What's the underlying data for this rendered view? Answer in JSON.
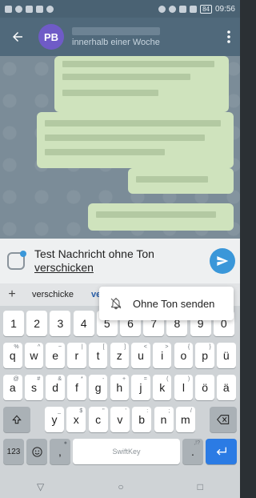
{
  "status_bar": {
    "battery": "84",
    "time": "09:56"
  },
  "header": {
    "back_icon": "arrow-left-icon",
    "avatar_initials": "PB",
    "subtitle": "innerhalb einer Woche",
    "menu_icon": "more-vertical-icon"
  },
  "composer": {
    "text_line1": "Test Nachricht ohne Ton",
    "text_line2": "verschicken",
    "sticker_icon": "sticker-icon",
    "send_icon": "send-icon"
  },
  "suggestions": {
    "add": "+",
    "word1": "verschicke",
    "word2": "ve"
  },
  "popup": {
    "label": "Ohne Ton senden",
    "icon": "bell-off-icon"
  },
  "keyboard": {
    "row1": [
      {
        "k": "1"
      },
      {
        "k": "2"
      },
      {
        "k": "3"
      },
      {
        "k": "4"
      },
      {
        "k": "5"
      },
      {
        "k": "6"
      },
      {
        "k": "7"
      },
      {
        "k": "8"
      },
      {
        "k": "9"
      },
      {
        "k": "0"
      }
    ],
    "row2": [
      {
        "k": "q",
        "s": "%"
      },
      {
        "k": "w",
        "s": "^"
      },
      {
        "k": "e",
        "s": "~"
      },
      {
        "k": "r",
        "s": "|"
      },
      {
        "k": "t",
        "s": "["
      },
      {
        "k": "z",
        "s": "]"
      },
      {
        "k": "u",
        "s": "<"
      },
      {
        "k": "i",
        "s": ">"
      },
      {
        "k": "o",
        "s": "{"
      },
      {
        "k": "p",
        "s": "}"
      },
      {
        "k": "ü"
      }
    ],
    "row3": [
      {
        "k": "a",
        "s": "@"
      },
      {
        "k": "s",
        "s": "#"
      },
      {
        "k": "d",
        "s": "&"
      },
      {
        "k": "f",
        "s": "*"
      },
      {
        "k": "g",
        "s": "-"
      },
      {
        "k": "h",
        "s": "+"
      },
      {
        "k": "j",
        "s": "="
      },
      {
        "k": "k",
        "s": "("
      },
      {
        "k": "l",
        "s": ")"
      },
      {
        "k": "ö"
      },
      {
        "k": "ä"
      }
    ],
    "row4": [
      {
        "k": "y",
        "s": "_"
      },
      {
        "k": "x",
        "s": "$"
      },
      {
        "k": "c",
        "s": "\""
      },
      {
        "k": "v",
        "s": "'"
      },
      {
        "k": "b",
        "s": ":"
      },
      {
        "k": "n",
        "s": ";"
      },
      {
        "k": "m",
        "s": "/"
      }
    ],
    "shift_icon": "shift-icon",
    "backspace_icon": "backspace-icon",
    "numbers_key": "123",
    "emoji_icon": "emoji-icon",
    "comma_key": ",",
    "space_label": "SwiftKey",
    "period_key": ".",
    "period_sub": ",!?",
    "enter_icon": "enter-icon"
  },
  "navbar": {
    "back_icon": "nav-back-icon",
    "home_icon": "nav-home-icon",
    "recents_icon": "nav-recents-icon"
  },
  "colors": {
    "appbar": "#50697b",
    "accent": "#3a97d9",
    "enter_key": "#2b7be4",
    "bubble": "#cfe3bd"
  }
}
